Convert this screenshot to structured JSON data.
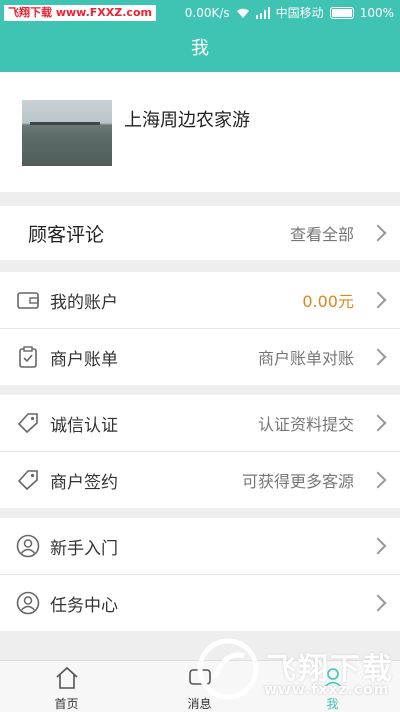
{
  "status_bar": {
    "watermark_site": "飞翔下载 www.FXXZ.com",
    "speed": "0.00K/s",
    "carrier": "中国移动",
    "battery": "100%"
  },
  "header": {
    "title": "我"
  },
  "profile": {
    "name": "上海周边农家游"
  },
  "reviews": {
    "title": "顾客评论",
    "link": "查看全部"
  },
  "account_section": [
    {
      "label": "我的账户",
      "value": "0.00元",
      "icon": "wallet-icon"
    },
    {
      "label": "商户账单",
      "value": "商户账单对账",
      "icon": "clipboard-check-icon"
    }
  ],
  "merchant_section": [
    {
      "label": "诚信认证",
      "value": "认证资料提交",
      "icon": "tag-icon"
    },
    {
      "label": "商户签约",
      "value": "可获得更多客源",
      "icon": "tag-icon"
    }
  ],
  "help_section": [
    {
      "label": "新手入门",
      "icon": "user-circle-icon"
    },
    {
      "label": "任务中心",
      "icon": "user-circle-icon"
    }
  ],
  "tab_bar": [
    {
      "label": "首页",
      "icon": "home-icon",
      "active": false
    },
    {
      "label": "消息",
      "icon": "message-icon",
      "active": false
    },
    {
      "label": "我",
      "icon": "user-icon",
      "active": true
    }
  ],
  "watermark": {
    "text": "飞翔下载",
    "url": "www.fxxz.com"
  },
  "colors": {
    "primary": "#3fc4b4",
    "money": "#d9881b"
  }
}
